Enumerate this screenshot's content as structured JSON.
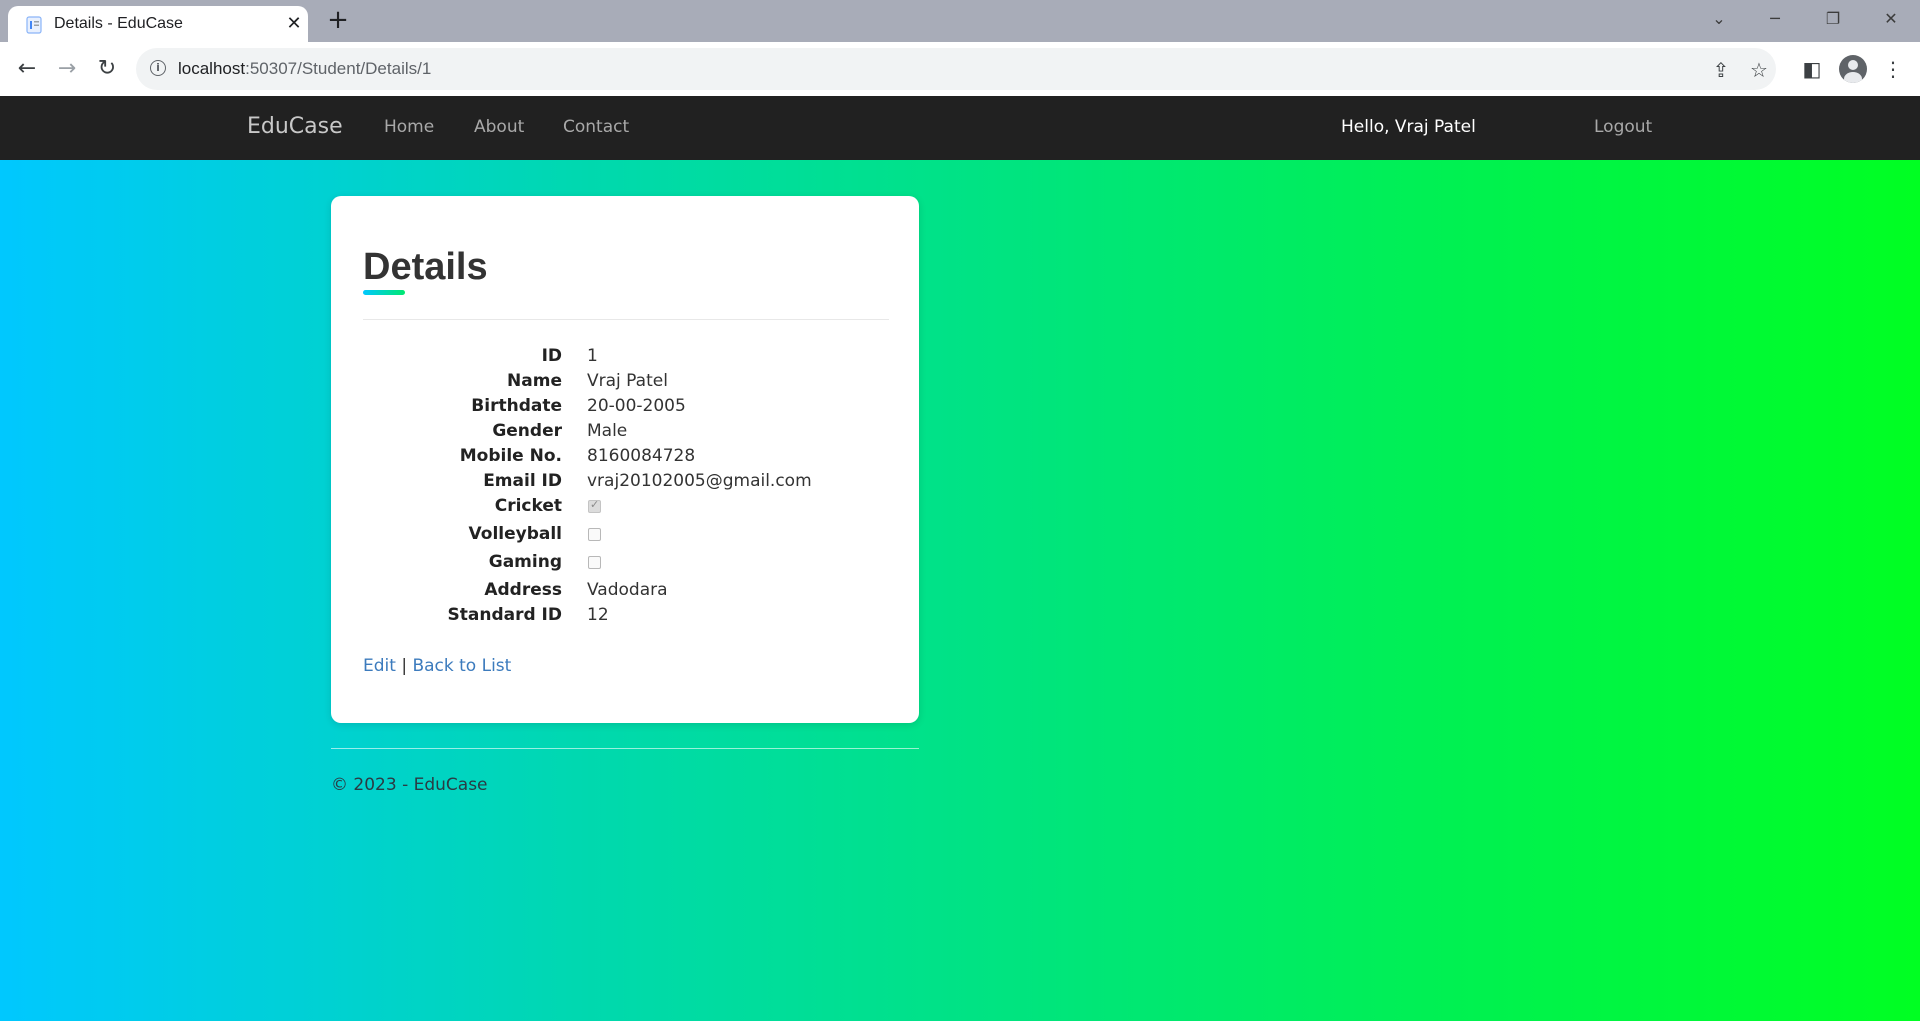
{
  "browser": {
    "tab_title": "Details - EduCase",
    "url_host": "localhost",
    "url_rest": ":50307/Student/Details/1"
  },
  "navbar": {
    "brand": "EduCase",
    "links": [
      "Home",
      "About",
      "Contact"
    ],
    "greeting": "Hello, Vraj Patel",
    "logout": "Logout"
  },
  "details": {
    "title": "Details",
    "fields": [
      {
        "label": "ID",
        "value": "1"
      },
      {
        "label": "Name",
        "value": "Vraj Patel"
      },
      {
        "label": "Birthdate",
        "value": "20-00-2005"
      },
      {
        "label": "Gender",
        "value": "Male"
      },
      {
        "label": "Mobile No.",
        "value": "8160084728"
      },
      {
        "label": "Email ID",
        "value": "vraj20102005@gmail.com"
      },
      {
        "label": "Cricket",
        "checked": true
      },
      {
        "label": "Volleyball",
        "checked": false
      },
      {
        "label": "Gaming",
        "checked": false
      },
      {
        "label": "Address",
        "value": "Vadodara"
      },
      {
        "label": "Standard ID",
        "value": "12"
      }
    ],
    "edit_link": "Edit",
    "separator": "|",
    "back_link": "Back to List"
  },
  "footer": {
    "text": "© 2023 - EduCase"
  },
  "colors": {
    "navbar_bg": "#212121",
    "link": "#3c7bbd",
    "gradient_start": "#00c8ff",
    "gradient_end": "#00ff22"
  }
}
